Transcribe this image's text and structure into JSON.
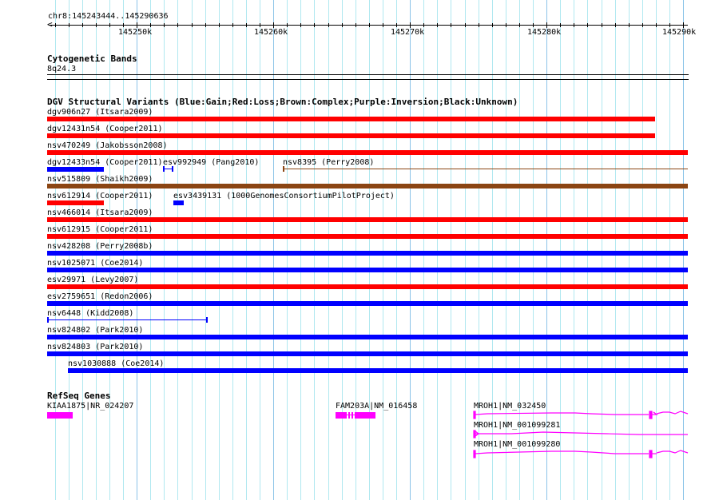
{
  "ruler": {
    "region": "chr8:145243444..145290636",
    "start": 145243444,
    "end": 145290636,
    "labels": [
      "145250k",
      "145260k",
      "145270k",
      "145280k",
      "145290k"
    ]
  },
  "cyto": {
    "title": "Cytogenetic Bands",
    "band": "8q24.3"
  },
  "dgv": {
    "title": "DGV Structural Variants (Blue:Gain;Red:Loss;Brown:Complex;Purple:Inversion;Black:Unknown)",
    "colors": {
      "gain": "#0000ff",
      "loss": "#ff0000",
      "complex": "#8b4513"
    },
    "features": [
      {
        "label": "dgv906n27 (Itsara2009)",
        "type": "loss"
      },
      {
        "label": "dgv12431n54 (Cooper2011)",
        "type": "loss"
      },
      {
        "label": "nsv470249 (Jakobsson2008)",
        "type": "loss"
      },
      {
        "label": "dgv12433n54 (Cooper2011)",
        "type": "gain"
      },
      {
        "label": "esv992949 (Pang2010)",
        "type": "gain"
      },
      {
        "label": "nsv8395 (Perry2008)",
        "type": "complex"
      },
      {
        "label": "nsv515809 (Shaikh2009)",
        "type": "complex"
      },
      {
        "label": "nsv612914 (Cooper2011)",
        "type": "loss"
      },
      {
        "label": "esv3439131 (1000GenomesConsortiumPilotProject)",
        "type": "gain"
      },
      {
        "label": "nsv466014 (Itsara2009)",
        "type": "loss"
      },
      {
        "label": "nsv612915 (Cooper2011)",
        "type": "loss"
      },
      {
        "label": "nsv428208 (Perry2008b)",
        "type": "gain"
      },
      {
        "label": "nsv1025071 (Coe2014)",
        "type": "gain"
      },
      {
        "label": "esv29971 (Levy2007)",
        "type": "loss"
      },
      {
        "label": "esv2759651 (Redon2006)",
        "type": "gain"
      },
      {
        "label": "nsv6448 (Kidd2008)",
        "type": "gain"
      },
      {
        "label": "nsv824802 (Park2010)",
        "type": "gain"
      },
      {
        "label": "nsv824803 (Park2010)",
        "type": "gain"
      },
      {
        "label": "nsv1030888 (Coe2014)",
        "type": "gain"
      }
    ]
  },
  "refseq": {
    "title": "RefSeq Genes",
    "color": "#ff00ff",
    "genes": [
      "KIAA1875|NR_024207",
      "FAM203A|NM_016458",
      "MROH1|NM_032450",
      "MROH1|NM_001099281",
      "MROH1|NM_001099280"
    ]
  }
}
